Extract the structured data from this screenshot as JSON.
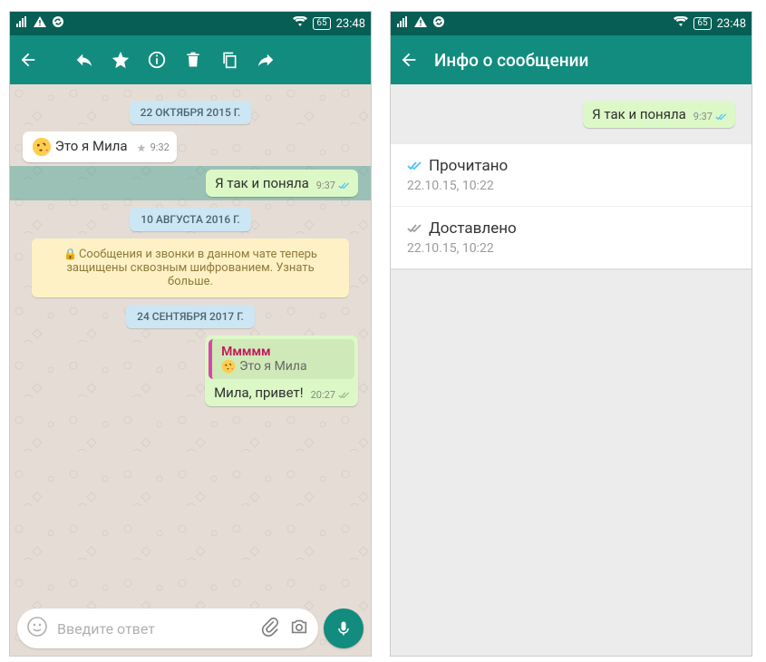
{
  "status": {
    "battery": "65",
    "time": "23:48"
  },
  "chat": {
    "date1": "22 ОКТЯБРЯ 2015 Г.",
    "msg1_text": "Это я Мила",
    "msg1_time": "9:32",
    "msg2_text": "Я так и поняла",
    "msg2_time": "9:37",
    "date2": "10 АВГУСТА 2016 Г.",
    "enc_text": "Сообщения и звонки в данном чате теперь защищены сквозным шифрованием. Узнать больше.",
    "date3": "24 СЕНТЯБРЯ 2017 Г.",
    "quote_name": "Ммммм",
    "quote_text": "Это я Мила",
    "msg3_text": "Мила, привет!",
    "msg3_time": "20:27",
    "input_placeholder": "Введите ответ"
  },
  "info": {
    "title": "Инфо о сообщении",
    "bubble_text": "Я так и поняла",
    "bubble_time": "9:37",
    "read_label": "Прочитано",
    "read_time": "22.10.15, 10:22",
    "delivered_label": "Доставлено",
    "delivered_time": "22.10.15, 10:22"
  }
}
